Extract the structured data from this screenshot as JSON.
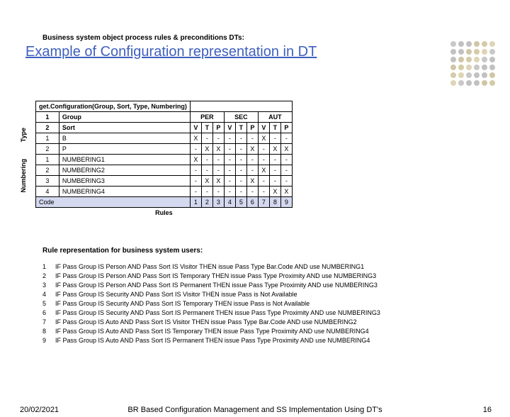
{
  "title": "Example of Configuration representation in DT",
  "section1": "Business system object process rules & preconditions DTs:",
  "table": {
    "caption": "get.Configuration(Group, Sort, Type, Numbering)",
    "vlabel_type": "Type",
    "vlabel_num": "Numbering",
    "group_label": "Group",
    "sort_label": "Sort",
    "groups": [
      "PER",
      "SEC",
      "AUT"
    ],
    "subheads": [
      "V",
      "T",
      "P",
      "V",
      "T",
      "P",
      "V",
      "T",
      "P"
    ],
    "type_rows": [
      {
        "n": "1",
        "name": "B",
        "cells": [
          "X",
          "-",
          "-",
          "-",
          "-",
          "-",
          "X",
          "-",
          "-"
        ]
      },
      {
        "n": "2",
        "name": "P",
        "cells": [
          "-",
          "X",
          "X",
          "-",
          "-",
          "X",
          "-",
          "X",
          "X"
        ]
      }
    ],
    "num_rows": [
      {
        "n": "1",
        "name": "NUMBERING1",
        "cells": [
          "X",
          "-",
          "-",
          "-",
          "-",
          "-",
          "-",
          "-",
          "-"
        ]
      },
      {
        "n": "2",
        "name": "NUMBERING2",
        "cells": [
          "-",
          "-",
          "-",
          "-",
          "-",
          "-",
          "X",
          "-",
          "-"
        ]
      },
      {
        "n": "3",
        "name": "NUMBERING3",
        "cells": [
          "-",
          "X",
          "X",
          "-",
          "-",
          "X",
          "-",
          "-",
          "-"
        ]
      },
      {
        "n": "4",
        "name": "NUMBERING4",
        "cells": [
          "-",
          "-",
          "-",
          "-",
          "-",
          "-",
          "-",
          "X",
          "X"
        ]
      }
    ],
    "code_label": "Code",
    "code_cells": [
      "1",
      "2",
      "3",
      "4",
      "5",
      "6",
      "7",
      "8",
      "9"
    ],
    "rules_label": "Rules"
  },
  "section2": "Rule representation for business system users:",
  "rules": [
    {
      "n": "1",
      "text": "IF Pass Group IS Person AND Pass Sort IS Visitor THEN issue Pass Type Bar.Code AND use NUMBERING1"
    },
    {
      "n": "2",
      "text": "IF Pass Group IS Person AND Pass Sort IS Temporary THEN issue Pass Type Proximity AND use NUMBERING3"
    },
    {
      "n": "3",
      "text": "IF Pass Group IS Person AND Pass Sort IS Permanent THEN issue Pass Type Proximity AND use NUMBERING3"
    },
    {
      "n": "4",
      "text": "IF Pass Group IS Security AND Pass Sort IS Visitor THEN issue Pass is Not Available"
    },
    {
      "n": "5",
      "text": "IF Pass Group IS Security AND Pass Sort IS Temporary THEN issue Pass is Not Available"
    },
    {
      "n": "6",
      "text": "IF Pass Group IS Security AND Pass Sort IS Permanent THEN issue Pass Type Proximity AND use NUMBERING3"
    },
    {
      "n": "7",
      "text": "IF Pass Group IS Auto AND Pass Sort IS Visitor THEN issue Pass Type Bar.Code AND use NUMBERING2"
    },
    {
      "n": "8",
      "text": "IF Pass Group IS Auto AND Pass Sort IS Temporary THEN issue Pass Type Proximity AND use NUMBERING4"
    },
    {
      "n": "9",
      "text": "IF Pass Group IS Auto AND Pass Sort IS Permanent THEN issue Pass Type Proximity AND use NUMBERING4"
    }
  ],
  "footer": {
    "date": "20/02/2021",
    "title": "BR Based Configuration Management and SS Implementation Using DT's",
    "page": "16"
  },
  "deco_colors": [
    "#4a4a4a",
    "#6b6b6b",
    "#8d8d8d",
    "#b7a97a",
    "#c9bd90",
    "#d9d0ad"
  ]
}
